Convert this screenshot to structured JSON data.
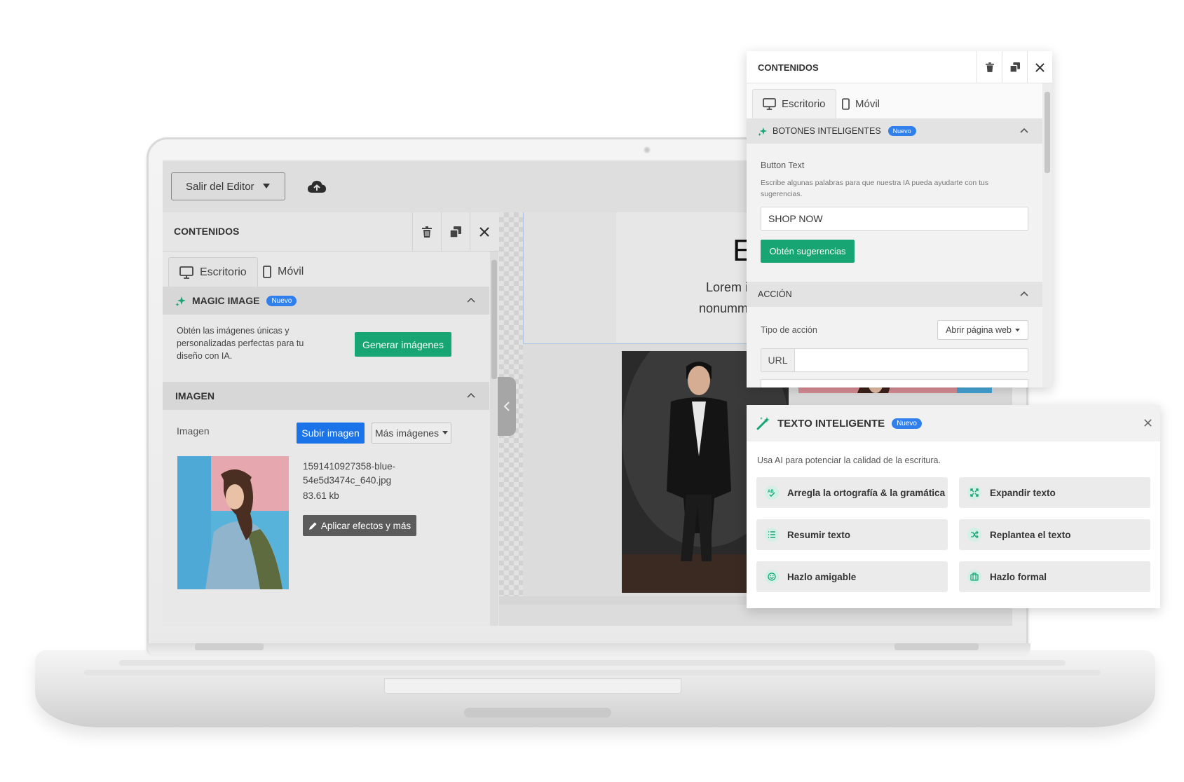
{
  "editor": {
    "exit_label": "Salir del Editor",
    "left_panel": {
      "title": "CONTENIDOS",
      "tabs": [
        {
          "label": "Escritorio",
          "icon": "desktop-icon"
        },
        {
          "label": "Móvil",
          "icon": "mobile-icon"
        }
      ],
      "magic_image": {
        "title": "MAGIC IMAGE",
        "badge": "Nuevo",
        "description": "Obtén las imágenes únicas y personalizadas perfectas para tu diseño con IA.",
        "button": "Generar imágenes"
      },
      "image_section": {
        "title": "IMAGEN",
        "label": "Imagen",
        "upload_button": "Subir imagen",
        "more_button": "Más imágenes",
        "filename_line1": "1591410927358-blue-",
        "filename_line2": "54e5d3474c_640.jpg",
        "filesize": "83.61 kb",
        "effects_button": "Aplicar efectos y más"
      }
    },
    "canvas": {
      "heading_letter": "E",
      "lorem_line1": "Lorem ip",
      "lorem_line2": "nonummy"
    }
  },
  "smart_buttons_panel": {
    "title": "CONTENIDOS",
    "tabs": [
      {
        "label": "Escritorio"
      },
      {
        "label": "Móvil"
      }
    ],
    "section_title": "BOTONES INTELIGENTES",
    "badge": "Nuevo",
    "field_label": "Button Text",
    "field_help": "Escribe algunas palabras para que nuestra IA pueda ayudarte con tus sugerencias.",
    "field_value": "SHOP NOW",
    "suggest_button": "Obtén sugerencias",
    "action_section": "ACCIÓN",
    "action_type_label": "Tipo de acción",
    "action_type_value": "Abrir página web",
    "url_label": "URL",
    "url_value": ""
  },
  "smart_text_panel": {
    "title": "TEXTO INTELIGENTE",
    "badge": "Nuevo",
    "description": "Usa AI para potenciar la calidad de la escritura.",
    "actions": [
      {
        "label": "Arregla la ortografía & la gramática",
        "icon": "spellcheck-icon"
      },
      {
        "label": "Expandir texto",
        "icon": "expand-icon"
      },
      {
        "label": "Resumir texto",
        "icon": "list-icon"
      },
      {
        "label": "Replantea el texto",
        "icon": "shuffle-icon"
      },
      {
        "label": "Hazlo amigable",
        "icon": "smile-icon"
      },
      {
        "label": "Hazlo formal",
        "icon": "briefcase-icon"
      }
    ]
  },
  "colors": {
    "accent_green": "#17a673",
    "accent_blue": "#1a73e8",
    "badge_blue": "#2f80ed",
    "icon_teal": "#17b07b"
  }
}
